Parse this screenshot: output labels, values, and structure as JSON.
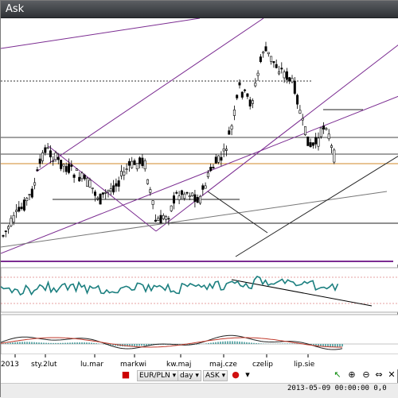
{
  "window": {
    "title": "Ask"
  },
  "instrument": "EUR/PLN",
  "chart_data": {
    "type": "candlestick",
    "title": "",
    "x_labels": [
      "2013",
      "sty.2lut",
      "lu.mar",
      "markwi",
      "kw.maj",
      "maj.cze",
      "czelip",
      "lip.sie"
    ],
    "x_label_start_year": "2013",
    "indicators": [
      "RSI",
      "MACD"
    ],
    "grid": true,
    "series_colors": {
      "candles": "#000000",
      "rsi": "#1b7f7f",
      "macd_signal": "#c0392b",
      "macd_histogram": "#2c8c8c",
      "channel_lines": "#7b2c91",
      "horizontal_support": "#d08a2a"
    }
  },
  "toolbar": {
    "symbol_label": "EUR/PLN",
    "period_label": "day",
    "price_label": "ASK",
    "icons": [
      "sell-icon",
      "cursor-icon",
      "zoom-in-icon",
      "zoom-out-icon",
      "fit-icon",
      "tools-icon"
    ]
  },
  "status": {
    "timestamp": "2013-05-09 00:00:00",
    "value": "0,0"
  }
}
